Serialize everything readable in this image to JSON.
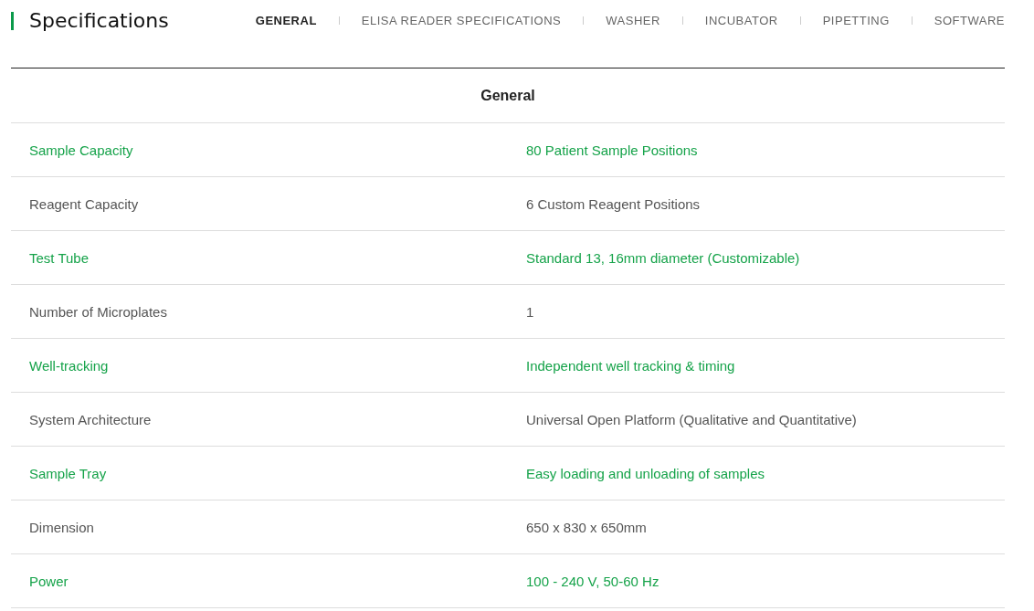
{
  "title": "Specifications",
  "tabs": [
    {
      "label": "GENERAL",
      "selected": true
    },
    {
      "label": "ELISA READER SPECIFICATIONS",
      "selected": false
    },
    {
      "label": "WASHER",
      "selected": false
    },
    {
      "label": "INCUBATOR",
      "selected": false
    },
    {
      "label": "PIPETTING",
      "selected": false
    },
    {
      "label": "SOFTWARE",
      "selected": false
    }
  ],
  "table": {
    "heading": "General",
    "rows": [
      {
        "label": "Sample Capacity",
        "value": "80 Patient Sample Positions"
      },
      {
        "label": "Reagent Capacity",
        "value": "6 Custom Reagent Positions"
      },
      {
        "label": "Test Tube",
        "value": "Standard 13, 16mm diameter (Customizable)"
      },
      {
        "label": "Number of Microplates",
        "value": "1"
      },
      {
        "label": "Well-tracking",
        "value": "Independent well tracking & timing"
      },
      {
        "label": "System Architecture",
        "value": "Universal Open Platform (Qualitative and Quantitative)"
      },
      {
        "label": "Sample Tray",
        "value": "Easy loading and unloading of samples"
      },
      {
        "label": "Dimension",
        "value": "650 x 830 x 650mm"
      },
      {
        "label": "Power",
        "value": "100 - 240 V, 50-60 Hz"
      }
    ]
  }
}
